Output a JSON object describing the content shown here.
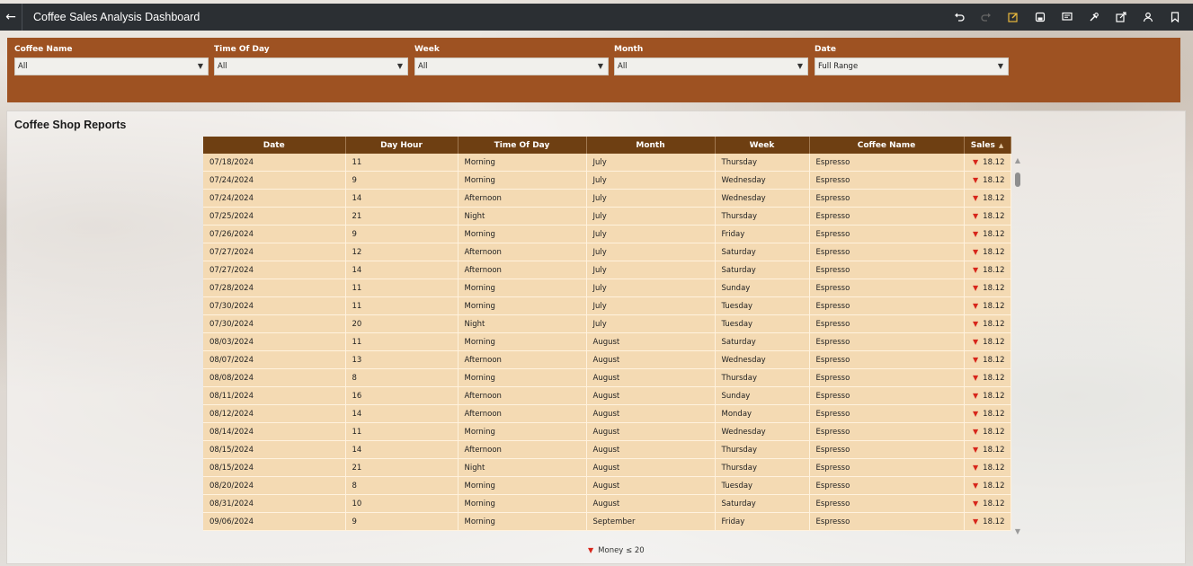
{
  "app": {
    "title": "Coffee Sales Analysis Dashboard",
    "toolbar_icons": [
      "undo-icon",
      "redo-icon",
      "edit-icon",
      "save-icon",
      "comment-icon",
      "tools-icon",
      "export-icon",
      "user-icon",
      "bookmark-icon"
    ]
  },
  "filters": [
    {
      "label": "Coffee Name",
      "value": "All"
    },
    {
      "label": "Time Of Day",
      "value": "All"
    },
    {
      "label": "Week",
      "value": "All"
    },
    {
      "label": "Month",
      "value": "All"
    },
    {
      "label": "Date",
      "value": "Full Range"
    }
  ],
  "report": {
    "title": "Coffee Shop Reports",
    "columns": [
      "Date",
      "Day Hour",
      "Time Of Day",
      "Month",
      "Week",
      "Coffee Name",
      "Sales"
    ],
    "rows": [
      [
        "07/18/2024",
        "11",
        "Morning",
        "July",
        "Thursday",
        "Espresso",
        "18.12"
      ],
      [
        "07/24/2024",
        "9",
        "Morning",
        "July",
        "Wednesday",
        "Espresso",
        "18.12"
      ],
      [
        "07/24/2024",
        "14",
        "Afternoon",
        "July",
        "Wednesday",
        "Espresso",
        "18.12"
      ],
      [
        "07/25/2024",
        "21",
        "Night",
        "July",
        "Thursday",
        "Espresso",
        "18.12"
      ],
      [
        "07/26/2024",
        "9",
        "Morning",
        "July",
        "Friday",
        "Espresso",
        "18.12"
      ],
      [
        "07/27/2024",
        "12",
        "Afternoon",
        "July",
        "Saturday",
        "Espresso",
        "18.12"
      ],
      [
        "07/27/2024",
        "14",
        "Afternoon",
        "July",
        "Saturday",
        "Espresso",
        "18.12"
      ],
      [
        "07/28/2024",
        "11",
        "Morning",
        "July",
        "Sunday",
        "Espresso",
        "18.12"
      ],
      [
        "07/30/2024",
        "11",
        "Morning",
        "July",
        "Tuesday",
        "Espresso",
        "18.12"
      ],
      [
        "07/30/2024",
        "20",
        "Night",
        "July",
        "Tuesday",
        "Espresso",
        "18.12"
      ],
      [
        "08/03/2024",
        "11",
        "Morning",
        "August",
        "Saturday",
        "Espresso",
        "18.12"
      ],
      [
        "08/07/2024",
        "13",
        "Afternoon",
        "August",
        "Wednesday",
        "Espresso",
        "18.12"
      ],
      [
        "08/08/2024",
        "8",
        "Morning",
        "August",
        "Thursday",
        "Espresso",
        "18.12"
      ],
      [
        "08/11/2024",
        "16",
        "Afternoon",
        "August",
        "Sunday",
        "Espresso",
        "18.12"
      ],
      [
        "08/12/2024",
        "14",
        "Afternoon",
        "August",
        "Monday",
        "Espresso",
        "18.12"
      ],
      [
        "08/14/2024",
        "11",
        "Morning",
        "August",
        "Wednesday",
        "Espresso",
        "18.12"
      ],
      [
        "08/15/2024",
        "14",
        "Afternoon",
        "August",
        "Thursday",
        "Espresso",
        "18.12"
      ],
      [
        "08/15/2024",
        "21",
        "Night",
        "August",
        "Thursday",
        "Espresso",
        "18.12"
      ],
      [
        "08/20/2024",
        "8",
        "Morning",
        "August",
        "Tuesday",
        "Espresso",
        "18.12"
      ],
      [
        "08/31/2024",
        "10",
        "Morning",
        "August",
        "Saturday",
        "Espresso",
        "18.12"
      ],
      [
        "09/06/2024",
        "9",
        "Morning",
        "September",
        "Friday",
        "Espresso",
        "18.12"
      ]
    ],
    "legend": "Money ≤ 20",
    "indicator_color": "#d7261b"
  },
  "colors": {
    "topbar": "#2b2f33",
    "filterbar": "#9e5222",
    "header": "#6e3f12",
    "cell": "#f4dab3"
  }
}
